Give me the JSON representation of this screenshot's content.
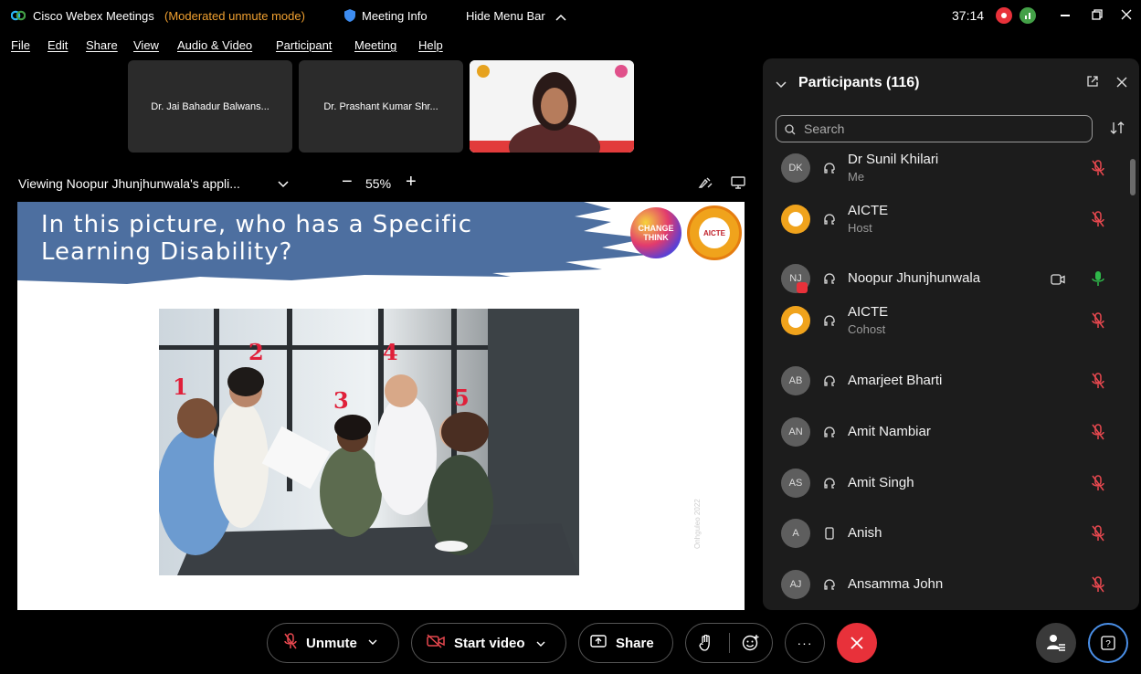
{
  "app": {
    "title": "Cisco Webex Meetings",
    "mode": "(Moderated unmute mode)",
    "meeting_info": "Meeting Info",
    "hide_menu": "Hide Menu Bar",
    "timer": "37:14"
  },
  "menu": [
    "File",
    "Edit",
    "Share",
    "View",
    "Audio & Video",
    "Participant",
    "Meeting",
    "Help"
  ],
  "tiles": [
    {
      "name": "Dr. Jai Bahadur Balwans..."
    },
    {
      "name": "Dr. Prashant Kumar Shr..."
    }
  ],
  "share": {
    "viewing": "Viewing Noopur Jhunjhunwala's appli...",
    "zoom": "55%",
    "minus": "−",
    "plus": "+"
  },
  "slide": {
    "title_line1": "In this picture, who has a Specific",
    "title_line2": "Learning Disability?",
    "badge_left": "CHANGE THINK",
    "badge_right": "AICTE",
    "numbers": [
      "1",
      "2",
      "3",
      "4",
      "5"
    ],
    "watermark": "Onhguleo 2022"
  },
  "participants": {
    "title": "Participants (116)",
    "search_placeholder": "Search",
    "list": [
      {
        "initials": "DK",
        "name": "Dr Sunil Khilari",
        "role": "Me",
        "device": "headset",
        "mic": "off"
      },
      {
        "initials": "",
        "name": "AICTE",
        "role": "Host",
        "device": "headset",
        "mic": "off",
        "logo": true
      },
      {
        "initials": "NJ",
        "name": "Noopur Jhunjhunwala",
        "role": "",
        "device": "headset",
        "mic": "on",
        "video": true
      },
      {
        "initials": "",
        "name": "AICTE",
        "role": "Cohost",
        "device": "headset",
        "mic": "off",
        "logo": true
      },
      {
        "initials": "AB",
        "name": "Amarjeet Bharti",
        "role": "",
        "device": "headset",
        "mic": "off"
      },
      {
        "initials": "AN",
        "name": "Amit Nambiar",
        "role": "",
        "device": "headset",
        "mic": "off"
      },
      {
        "initials": "AS",
        "name": "Amit Singh",
        "role": "",
        "device": "headset",
        "mic": "off"
      },
      {
        "initials": "A",
        "name": "Anish",
        "role": "",
        "device": "phone",
        "mic": "off"
      },
      {
        "initials": "AJ",
        "name": "Ansamma John",
        "role": "",
        "device": "headset",
        "mic": "off"
      }
    ]
  },
  "controls": {
    "unmute": "Unmute",
    "start_video": "Start video",
    "share": "Share",
    "more": "···"
  },
  "colors": {
    "mode_orange": "#f0a030",
    "end_red": "#e8313a",
    "mic_off_red": "#e8484f",
    "mic_on_green": "#2fb84a",
    "slide_banner": "#4d6fa0"
  }
}
